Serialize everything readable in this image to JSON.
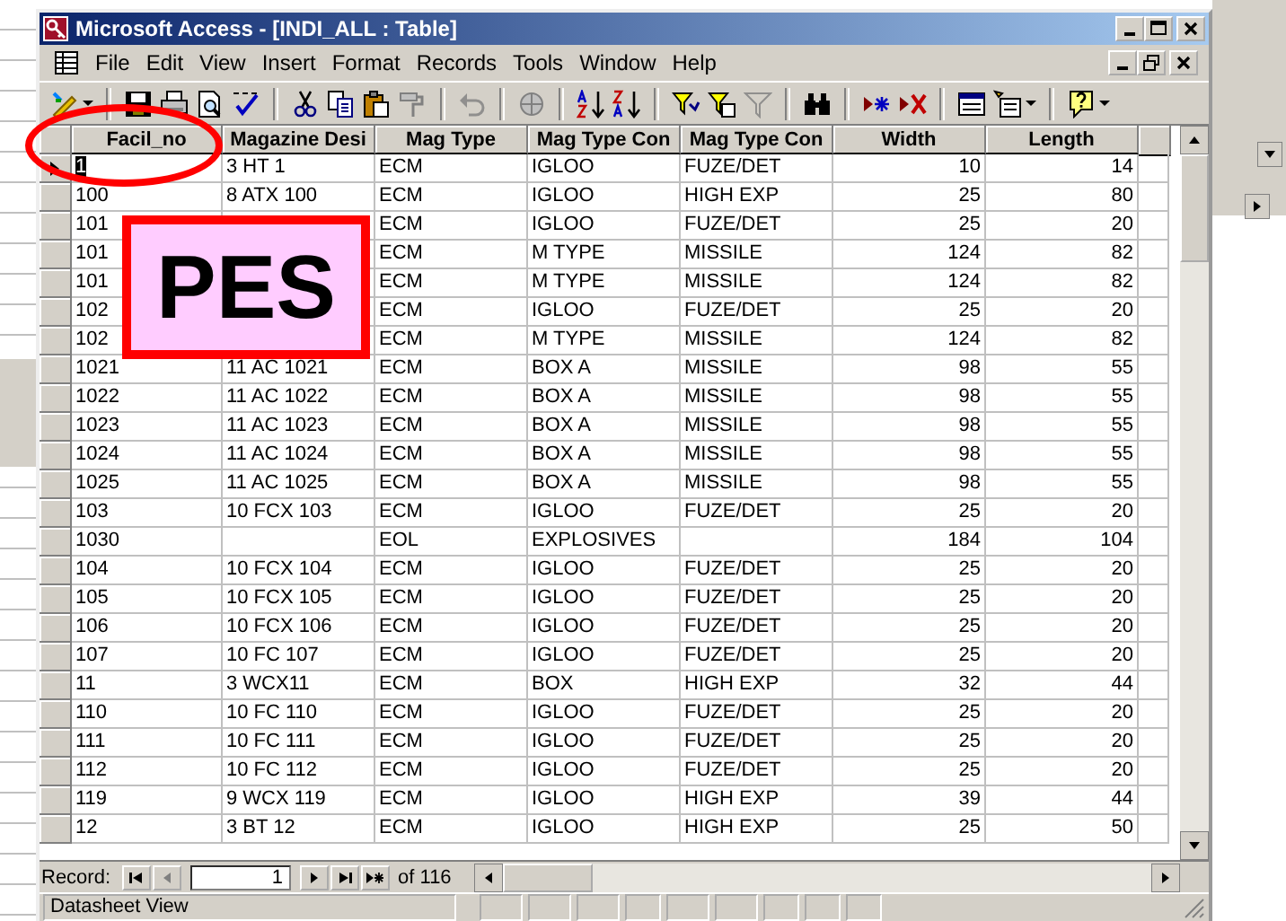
{
  "window": {
    "title": "Microsoft Access - [INDI_ALL : Table]"
  },
  "menu": [
    "File",
    "Edit",
    "View",
    "Insert",
    "Format",
    "Records",
    "Tools",
    "Window",
    "Help"
  ],
  "table": {
    "columns": [
      {
        "label": "Facil_no",
        "kind": "text"
      },
      {
        "label": "Magazine Desi",
        "kind": "text"
      },
      {
        "label": "Mag Type",
        "kind": "text"
      },
      {
        "label": "Mag Type Con",
        "kind": "text"
      },
      {
        "label": "Mag Type Con",
        "kind": "text"
      },
      {
        "label": "Width",
        "kind": "number"
      },
      {
        "label": "Length",
        "kind": "number"
      }
    ],
    "rows": [
      {
        "selected": true,
        "cells": [
          "1",
          "3 HT   1",
          "ECM",
          "IGLOO",
          "FUZE/DET",
          "10",
          "14"
        ]
      },
      {
        "selected": false,
        "cells": [
          "100",
          "8 ATX 100",
          "ECM",
          "IGLOO",
          "HIGH EXP",
          "25",
          "80"
        ]
      },
      {
        "selected": false,
        "cells": [
          "101",
          null,
          "ECM",
          "IGLOO",
          "FUZE/DET",
          "25",
          "20"
        ]
      },
      {
        "selected": false,
        "cells": [
          "101",
          null,
          "ECM",
          "M  TYPE",
          "MISSILE",
          "124",
          "82"
        ]
      },
      {
        "selected": false,
        "cells": [
          "101",
          null,
          "ECM",
          "M  TYPE",
          "MISSILE",
          "124",
          "82"
        ]
      },
      {
        "selected": false,
        "cells": [
          "102",
          null,
          "ECM",
          "IGLOO",
          "FUZE/DET",
          "25",
          "20"
        ]
      },
      {
        "selected": false,
        "cells": [
          "102",
          null,
          "ECM",
          "M  TYPE",
          "MISSILE",
          "124",
          "82"
        ]
      },
      {
        "selected": false,
        "cells": [
          "1021",
          "11 AC 1021",
          "ECM",
          "BOX A",
          "MISSILE",
          "98",
          "55"
        ]
      },
      {
        "selected": false,
        "cells": [
          "1022",
          "11 AC 1022",
          "ECM",
          "BOX A",
          "MISSILE",
          "98",
          "55"
        ]
      },
      {
        "selected": false,
        "cells": [
          "1023",
          "11 AC 1023",
          "ECM",
          "BOX A",
          "MISSILE",
          "98",
          "55"
        ]
      },
      {
        "selected": false,
        "cells": [
          "1024",
          "11 AC 1024",
          "ECM",
          "BOX A",
          "MISSILE",
          "98",
          "55"
        ]
      },
      {
        "selected": false,
        "cells": [
          "1025",
          "11 AC 1025",
          "ECM",
          "BOX A",
          "MISSILE",
          "98",
          "55"
        ]
      },
      {
        "selected": false,
        "cells": [
          "103",
          "10 FCX 103",
          "ECM",
          "IGLOO",
          "FUZE/DET",
          "25",
          "20"
        ]
      },
      {
        "selected": false,
        "cells": [
          "1030",
          null,
          "EOL",
          "EXPLOSIVES",
          null,
          "184",
          "104"
        ]
      },
      {
        "selected": false,
        "cells": [
          "104",
          "10 FCX 104",
          "ECM",
          "IGLOO",
          "FUZE/DET",
          "25",
          "20"
        ]
      },
      {
        "selected": false,
        "cells": [
          "105",
          "10 FCX 105",
          "ECM",
          "IGLOO",
          "FUZE/DET",
          "25",
          "20"
        ]
      },
      {
        "selected": false,
        "cells": [
          "106",
          "10 FCX 106",
          "ECM",
          "IGLOO",
          "FUZE/DET",
          "25",
          "20"
        ]
      },
      {
        "selected": false,
        "cells": [
          "107",
          "10 FC 107",
          "ECM",
          "IGLOO",
          "FUZE/DET",
          "25",
          "20"
        ]
      },
      {
        "selected": false,
        "cells": [
          "11",
          "3 WCX11",
          "ECM",
          "BOX",
          "HIGH EXP",
          "32",
          "44"
        ]
      },
      {
        "selected": false,
        "cells": [
          "110",
          "10 FC 110",
          "ECM",
          "IGLOO",
          "FUZE/DET",
          "25",
          "20"
        ]
      },
      {
        "selected": false,
        "cells": [
          "111",
          "10 FC 111",
          "ECM",
          "IGLOO",
          "FUZE/DET",
          "25",
          "20"
        ]
      },
      {
        "selected": false,
        "cells": [
          "112",
          "10 FC 112",
          "ECM",
          "IGLOO",
          "FUZE/DET",
          "25",
          "20"
        ]
      },
      {
        "selected": false,
        "cells": [
          "119",
          "9 WCX 119",
          "ECM",
          "IGLOO",
          "HIGH EXP",
          "39",
          "44"
        ]
      },
      {
        "selected": false,
        "cells": [
          "12",
          "3 BT   12",
          "ECM",
          "IGLOO",
          "HIGH EXP",
          "25",
          "50"
        ]
      }
    ]
  },
  "record_nav": {
    "label": "Record:",
    "current": "1",
    "total": "of 116"
  },
  "status_bar": {
    "text": "Datasheet View"
  },
  "annotations": [
    {
      "kind": "ellipse"
    },
    {
      "kind": "label",
      "text": "PES"
    }
  ]
}
